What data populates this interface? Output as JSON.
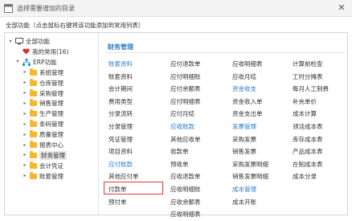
{
  "window": {
    "title": "选择需要增加的目录",
    "close_icon": "close-icon"
  },
  "hint": "全部功能（点击鼠标右键将该功能添加到常用列表）",
  "tree": [
    {
      "name": "tree-root-all",
      "label": "全部功能",
      "toggle": "▽",
      "icon": "monitor-icon"
    },
    {
      "name": "tree-favorites",
      "label": "我的常用(16)",
      "toggle": "",
      "icon": "heart-icon"
    },
    {
      "name": "tree-erp",
      "label": "ERP功能",
      "toggle": "▽",
      "icon": "org-chart-icon"
    },
    {
      "name": "tree-system-mgmt",
      "label": "系统管理",
      "toggle": "▷",
      "icon": "folder-icon"
    },
    {
      "name": "tree-warehouse-mgmt",
      "label": "仓库管理",
      "toggle": "▷",
      "icon": "folder-icon"
    },
    {
      "name": "tree-purchase-mgmt",
      "label": "采购管理",
      "toggle": "▷",
      "icon": "folder-icon"
    },
    {
      "name": "tree-sales-mgmt",
      "label": "销售管理",
      "toggle": "▷",
      "icon": "folder-icon"
    },
    {
      "name": "tree-production-mgmt",
      "label": "生产管理",
      "toggle": "▷",
      "icon": "folder-icon"
    },
    {
      "name": "tree-barcode-mgmt",
      "label": "条码管理",
      "toggle": "▷",
      "icon": "folder-icon"
    },
    {
      "name": "tree-quality-mgmt",
      "label": "质量管理",
      "toggle": "▷",
      "icon": "folder-icon"
    },
    {
      "name": "tree-reports",
      "label": "报表中心",
      "toggle": "▷",
      "icon": "folder-icon"
    },
    {
      "name": "tree-finance-mgmt",
      "label": "财务管理",
      "toggle": "▷",
      "icon": "folder-icon",
      "selected": true
    },
    {
      "name": "tree-accounting-voucher",
      "label": "会计凭证",
      "toggle": "▷",
      "icon": "folder-icon"
    },
    {
      "name": "tree-ledger-mgmt",
      "label": "账套管理",
      "toggle": "▷",
      "icon": "folder-icon"
    }
  ],
  "section_title": "财务管理",
  "columns": [
    [
      {
        "label": "账套资料",
        "type": "header"
      },
      {
        "label": "账套资料",
        "type": "item"
      },
      {
        "label": "会计期间",
        "type": "item"
      },
      {
        "label": "费用类型",
        "type": "item"
      },
      {
        "label": "分录流转",
        "type": "item"
      },
      {
        "label": "分录管理",
        "type": "item"
      },
      {
        "label": "凭证管理",
        "type": "item"
      },
      {
        "label": "项目资料",
        "type": "item"
      },
      {
        "label": "应付账款",
        "type": "header"
      },
      {
        "label": "其他应付单",
        "type": "item"
      },
      {
        "label": "付款单",
        "type": "item",
        "highlighted": true
      },
      {
        "label": "预付单",
        "type": "item"
      }
    ],
    [
      {
        "label": "应付退款单",
        "type": "item"
      },
      {
        "label": "应付明细账",
        "type": "item"
      },
      {
        "label": "应付余额表",
        "type": "item"
      },
      {
        "label": "应付明细表",
        "type": "item"
      },
      {
        "label": "应付月结",
        "type": "item"
      },
      {
        "label": "应收账款",
        "type": "header"
      },
      {
        "label": "其他应收单",
        "type": "item"
      },
      {
        "label": "收款单",
        "type": "item"
      },
      {
        "label": "预收单",
        "type": "item"
      },
      {
        "label": "应收退款单",
        "type": "item"
      },
      {
        "label": "应收明细账",
        "type": "item"
      },
      {
        "label": "应收余额表",
        "type": "item"
      },
      {
        "label": "应收明细表",
        "type": "item"
      }
    ],
    [
      {
        "label": "应收明细表",
        "type": "item"
      },
      {
        "label": "应收月结",
        "type": "item"
      },
      {
        "label": "资金收支",
        "type": "header"
      },
      {
        "label": "资金收入单",
        "type": "item"
      },
      {
        "label": "资金支出单",
        "type": "item"
      },
      {
        "label": "发票管理",
        "type": "header"
      },
      {
        "label": "采购发票",
        "type": "item"
      },
      {
        "label": "销售发票",
        "type": "item"
      },
      {
        "label": "采购发票明细",
        "type": "item"
      },
      {
        "label": "销售发票明细",
        "type": "item"
      },
      {
        "label": "成本管理",
        "type": "header"
      },
      {
        "label": "成本开账",
        "type": "item"
      }
    ],
    [
      {
        "label": "计算前检查",
        "type": "item"
      },
      {
        "label": "工时分摊表",
        "type": "item"
      },
      {
        "label": "每月人工制费",
        "type": "item"
      },
      {
        "label": "补充单价",
        "type": "item"
      },
      {
        "label": "成本计算",
        "type": "item"
      },
      {
        "label": "领活成本表",
        "type": "item"
      },
      {
        "label": "库存成本表",
        "type": "item"
      },
      {
        "label": "产品成本表",
        "type": "item"
      },
      {
        "label": "在制成本表",
        "type": "item"
      },
      {
        "label": "成本分录",
        "type": "item"
      }
    ]
  ]
}
